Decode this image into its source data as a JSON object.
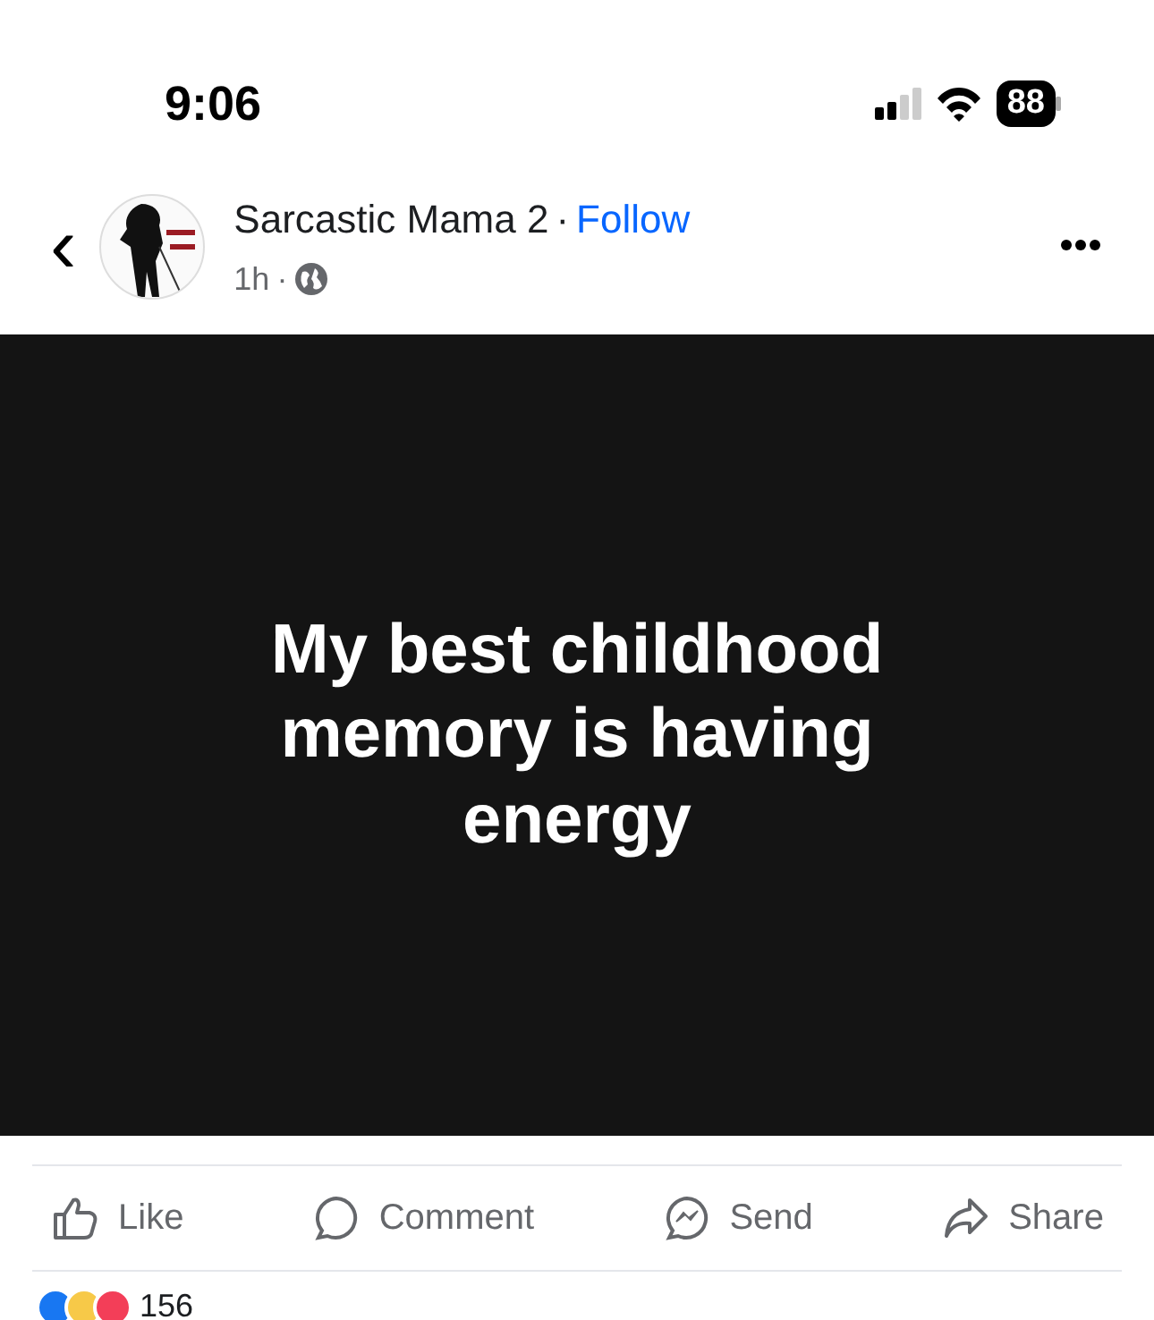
{
  "status_bar": {
    "time": "9:06",
    "battery": "88"
  },
  "post_header": {
    "back": "‹",
    "author": "Sarcastic Mama 2",
    "separator": "·",
    "follow": "Follow",
    "age": "1h",
    "age_separator": "·"
  },
  "post": {
    "text": "My best childhood memory is having energy"
  },
  "actions": [
    {
      "kind": "like",
      "label": "Like"
    },
    {
      "kind": "comment",
      "label": "Comment"
    },
    {
      "kind": "send",
      "label": "Send"
    },
    {
      "kind": "share",
      "label": "Share"
    }
  ],
  "reactions": {
    "count": "156"
  }
}
